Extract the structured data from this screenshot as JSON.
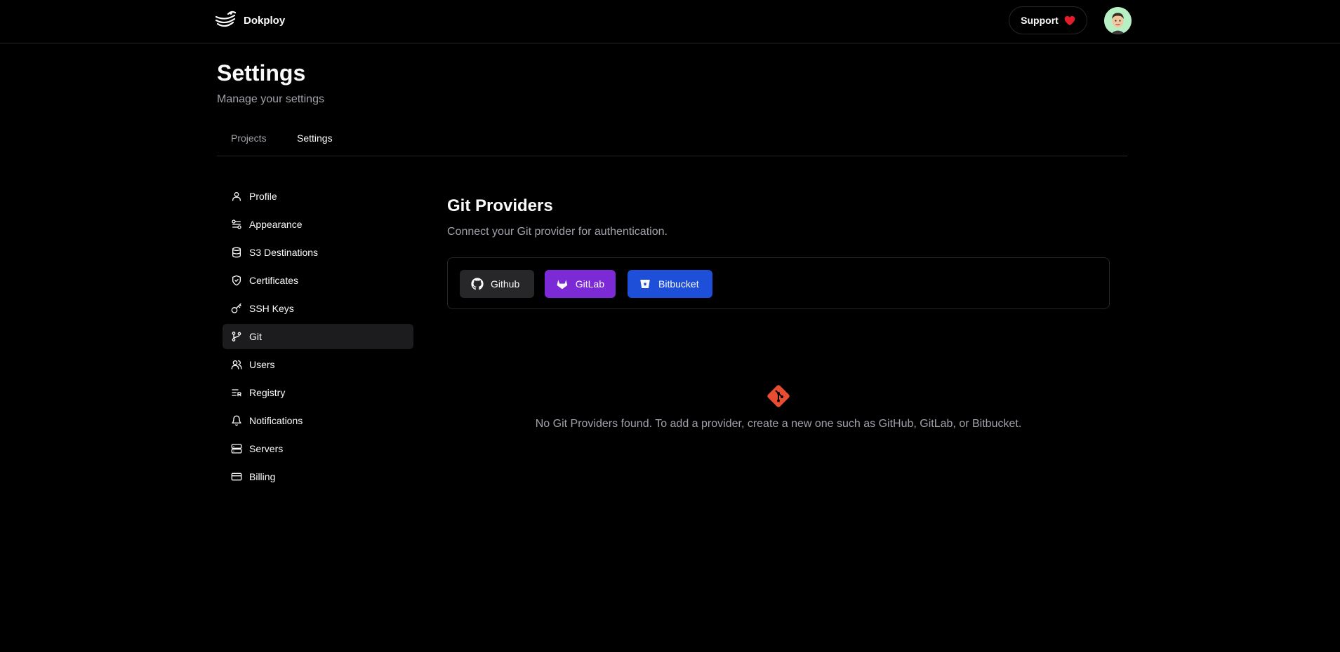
{
  "app": {
    "name": "Dokploy"
  },
  "header": {
    "support_label": "Support"
  },
  "page": {
    "title": "Settings",
    "subtitle": "Manage your settings"
  },
  "tabs": [
    {
      "label": "Projects"
    },
    {
      "label": "Settings"
    }
  ],
  "sidebar": {
    "items": [
      {
        "label": "Profile",
        "icon": "user-icon"
      },
      {
        "label": "Appearance",
        "icon": "appearance-icon"
      },
      {
        "label": "S3 Destinations",
        "icon": "database-icon"
      },
      {
        "label": "Certificates",
        "icon": "shield-check-icon"
      },
      {
        "label": "SSH Keys",
        "icon": "key-icon"
      },
      {
        "label": "Git",
        "icon": "git-branch-icon"
      },
      {
        "label": "Users",
        "icon": "users-icon"
      },
      {
        "label": "Registry",
        "icon": "registry-icon"
      },
      {
        "label": "Notifications",
        "icon": "bell-icon"
      },
      {
        "label": "Servers",
        "icon": "server-icon"
      },
      {
        "label": "Billing",
        "icon": "credit-card-icon"
      }
    ],
    "active": "Git"
  },
  "git_providers": {
    "title": "Git Providers",
    "description": "Connect your Git provider for authentication.",
    "buttons": {
      "github": "Github",
      "gitlab": "GitLab",
      "bitbucket": "Bitbucket"
    },
    "empty_message": "No Git Providers found. To add a provider, create a new one such as GitHub, GitLab, or Bitbucket."
  },
  "colors": {
    "background": "#000000",
    "github_button": "#27272a",
    "gitlab_button": "#7b2ad6",
    "bitbucket_button": "#1e4fd8",
    "git_logo": "#e84d31",
    "heart": "#e11d2a"
  }
}
